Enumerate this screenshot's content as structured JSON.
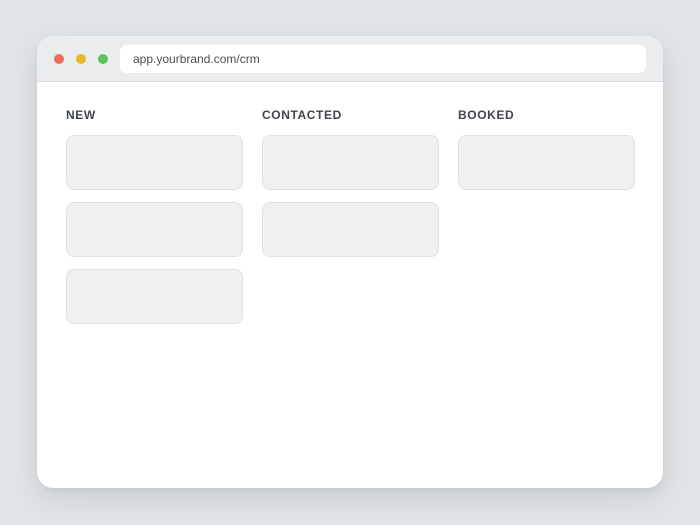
{
  "browser": {
    "url": "app.yourbrand.com/crm",
    "controls": [
      "close",
      "minimize",
      "maximize"
    ]
  },
  "board": {
    "columns": [
      {
        "title": "NEW",
        "card_count": 3
      },
      {
        "title": "CONTACTED",
        "card_count": 2
      },
      {
        "title": "BOOKED",
        "card_count": 1
      }
    ]
  },
  "colors": {
    "page_background": "#e1e4e7",
    "window_background": "#ffffff",
    "titlebar_background": "#ebeced",
    "card_background": "#eef0f1",
    "close_dot": "#ee6b60",
    "minimize_dot": "#e8b72e",
    "maximize_dot": "#5ec15a"
  }
}
